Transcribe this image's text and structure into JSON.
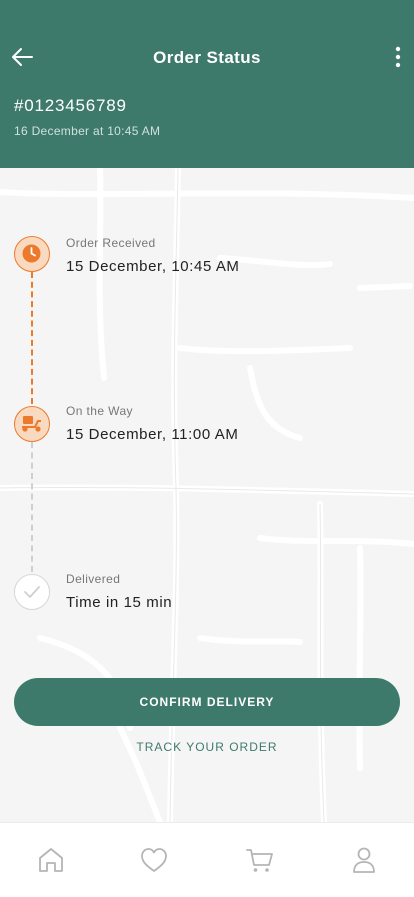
{
  "header": {
    "title": "Order Status",
    "order_id": "#0123456789",
    "order_date": "16 December at 10:45 AM",
    "back_icon": "arrow-left-icon",
    "menu_icon": "more-vertical-icon"
  },
  "timeline": {
    "steps": [
      {
        "label": "Order Received",
        "value": "15 December, 10:45 AM",
        "status": "complete",
        "icon": "clock-icon"
      },
      {
        "label": "On the Way",
        "value": "15 December, 11:00 AM",
        "status": "complete",
        "icon": "delivery-scooter-icon"
      },
      {
        "label": "Delivered",
        "value": "Time in 15 min",
        "status": "pending",
        "icon": "check-icon"
      }
    ]
  },
  "actions": {
    "confirm_label": "CONFIRM DELIVERY",
    "track_label": "TRACK YOUR ORDER"
  },
  "tabbar": {
    "items": [
      {
        "icon": "home-icon"
      },
      {
        "icon": "heart-icon"
      },
      {
        "icon": "cart-icon"
      },
      {
        "icon": "user-icon"
      }
    ]
  },
  "colors": {
    "primary": "#3e7a6c",
    "accent": "#ec7a2c",
    "inactive": "#cfcfcf"
  }
}
